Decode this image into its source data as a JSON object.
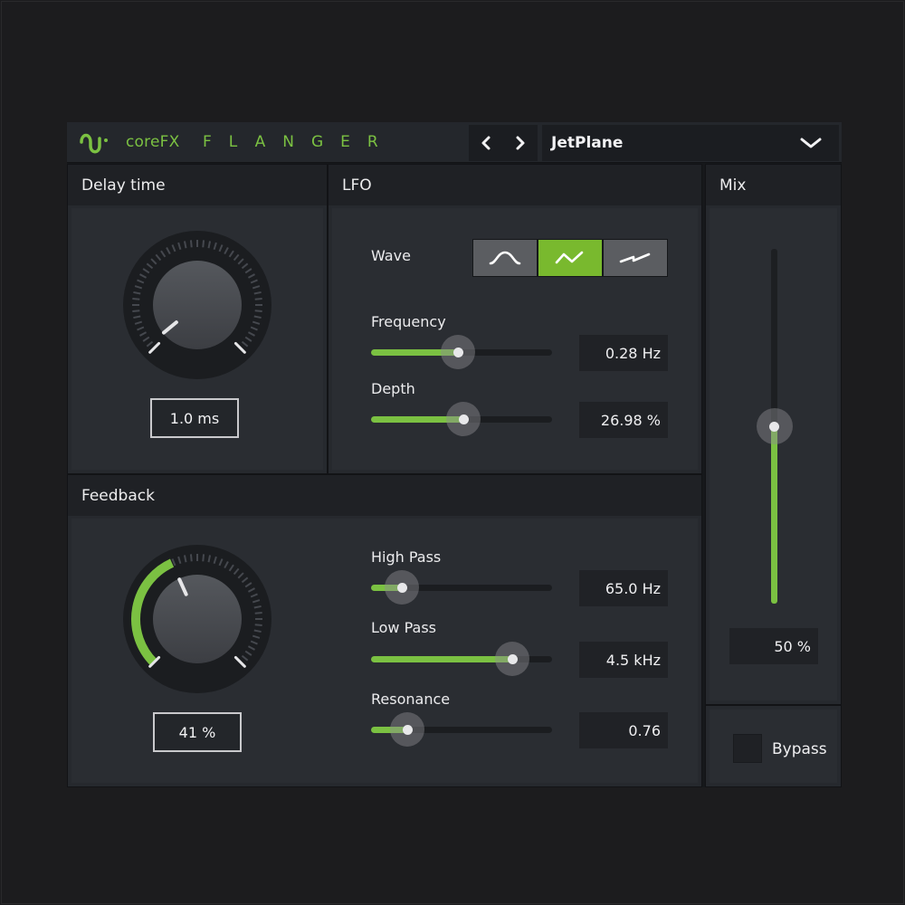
{
  "header": {
    "brand": "coreFX",
    "product": "FLANGER",
    "logo_icon": "wave-logo-icon",
    "prev_icon": "chevron-left-icon",
    "next_icon": "chevron-right-icon",
    "preset": {
      "selected": "JetPlane",
      "icon": "chevron-down-icon"
    }
  },
  "colors": {
    "accent": "#7bc142",
    "background": "#1c1c1e",
    "panel": "#26292e"
  },
  "delay_time": {
    "title": "Delay time",
    "value_label": "1.0 ms",
    "knob_fraction": 0.02
  },
  "lfo": {
    "title": "LFO",
    "wave": {
      "label": "Wave",
      "options": [
        {
          "name": "sine",
          "icon": "sine-wave-icon",
          "active": false
        },
        {
          "name": "triangle",
          "icon": "triangle-wave-icon",
          "active": true
        },
        {
          "name": "sawtooth",
          "icon": "sawtooth-wave-icon",
          "active": false
        }
      ]
    },
    "frequency": {
      "label": "Frequency",
      "value_label": "0.28 Hz",
      "fraction": 0.48
    },
    "depth": {
      "label": "Depth",
      "value_label": "26.98 %",
      "fraction": 0.51
    }
  },
  "feedback": {
    "title": "Feedback",
    "value_label": "41 %",
    "knob_fraction": 0.41,
    "high_pass": {
      "label": "High Pass",
      "value_label": "65.0 Hz",
      "fraction": 0.17
    },
    "low_pass": {
      "label": "Low Pass",
      "value_label": "4.5 kHz",
      "fraction": 0.78
    },
    "resonance": {
      "label": "Resonance",
      "value_label": "0.76",
      "fraction": 0.2
    }
  },
  "mix": {
    "title": "Mix",
    "value_label": "50 %",
    "fraction": 0.5
  },
  "bypass": {
    "label": "Bypass",
    "checked": false
  }
}
